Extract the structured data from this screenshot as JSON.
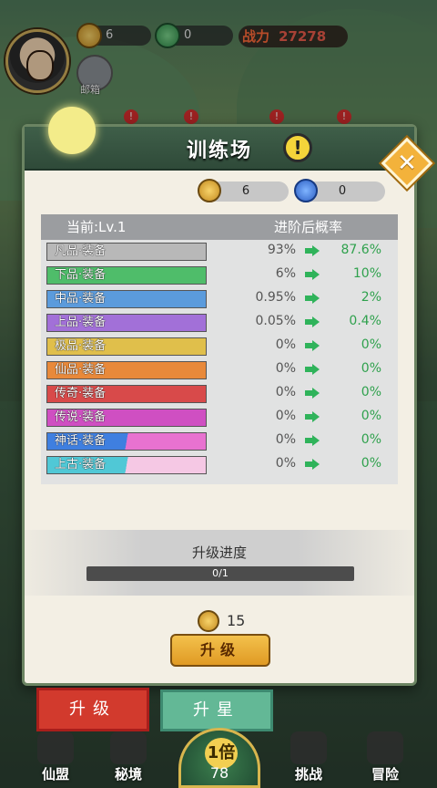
{
  "hud": {
    "currency1": "6",
    "currency2": "0",
    "power_label": "战力",
    "power_value": "27278",
    "mail_label": "邮箱"
  },
  "panel": {
    "title": "训练场",
    "info_icon": "!",
    "close_icon": "✕",
    "currency1": "6",
    "currency2": "0",
    "table": {
      "header_current": "当前:Lv.1",
      "header_next": "进阶后概率",
      "rows": [
        {
          "name": "凡品·装备",
          "before": "93%",
          "after": "87.6%",
          "color": "#b8b8b8"
        },
        {
          "name": "下品·装备",
          "before": "6%",
          "after": "10%",
          "color": "#4fbd6a"
        },
        {
          "name": "中品·装备",
          "before": "0.95%",
          "after": "2%",
          "color": "#5b9bdc"
        },
        {
          "name": "上品·装备",
          "before": "0.05%",
          "after": "0.4%",
          "color": "#a270d8"
        },
        {
          "name": "极品·装备",
          "before": "0%",
          "after": "0%",
          "color": "#e0bf4b"
        },
        {
          "name": "仙品·装备",
          "before": "0%",
          "after": "0%",
          "color": "#e8893a"
        },
        {
          "name": "传奇·装备",
          "before": "0%",
          "after": "0%",
          "color": "#d84a4a"
        },
        {
          "name": "传说·装备",
          "before": "0%",
          "after": "0%",
          "color": "#cf4fc2"
        },
        {
          "name": "神话·装备",
          "before": "0%",
          "after": "0%",
          "color": "#3f7fe0",
          "color2": "#e872d0"
        },
        {
          "name": "上古·装备",
          "before": "0%",
          "after": "0%",
          "color": "#50c8d6",
          "color2": "#f5c8e4"
        }
      ]
    },
    "progress": {
      "label": "升级进度",
      "text": "0/1",
      "fraction": 0
    },
    "cost": "15",
    "upgrade_button": "升级"
  },
  "tabs": {
    "left": "升级",
    "right": "升星"
  },
  "nav": {
    "items": [
      "仙盟",
      "秘境",
      "挑战",
      "冒险"
    ],
    "center_badge": "1倍",
    "center_number": "78"
  },
  "badge_marks": [
    "!",
    "!",
    "!",
    "!"
  ]
}
